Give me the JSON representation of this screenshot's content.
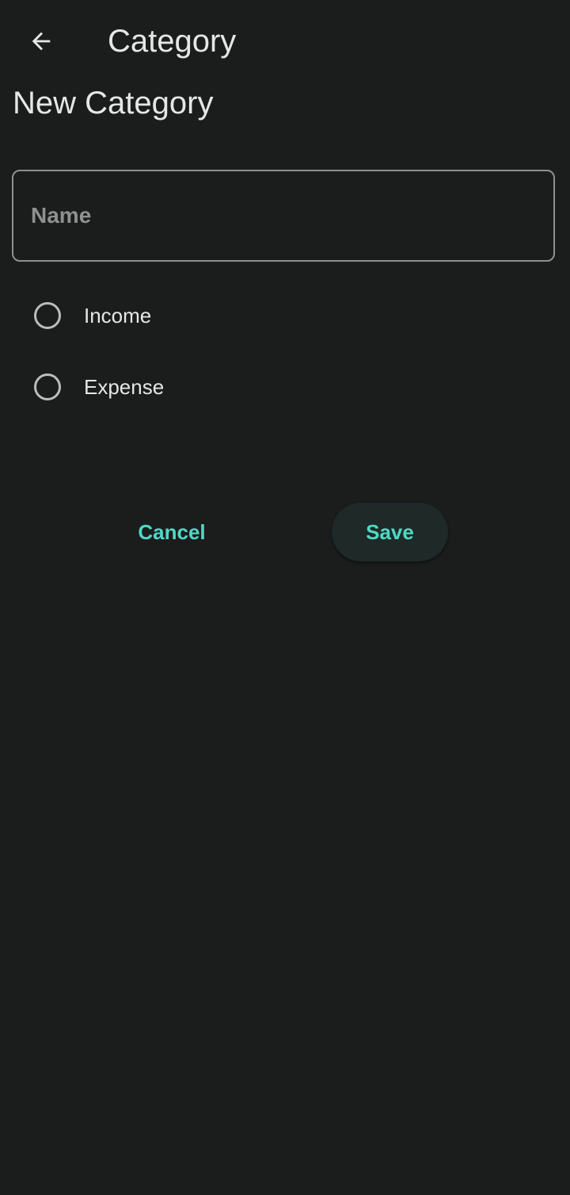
{
  "app_bar": {
    "title": "Category",
    "back_icon": "arrow-back-icon"
  },
  "page": {
    "heading": "New Category"
  },
  "form": {
    "name_field": {
      "placeholder": "Name",
      "value": ""
    },
    "type_options": [
      {
        "label": "Income",
        "selected": false
      },
      {
        "label": "Expense",
        "selected": false
      }
    ]
  },
  "actions": {
    "cancel_label": "Cancel",
    "save_label": "Save"
  },
  "colors": {
    "background": "#1b1c1c",
    "accent": "#4fd8c4",
    "outline": "#8e9190",
    "save_button_bg": "#1e2928"
  }
}
